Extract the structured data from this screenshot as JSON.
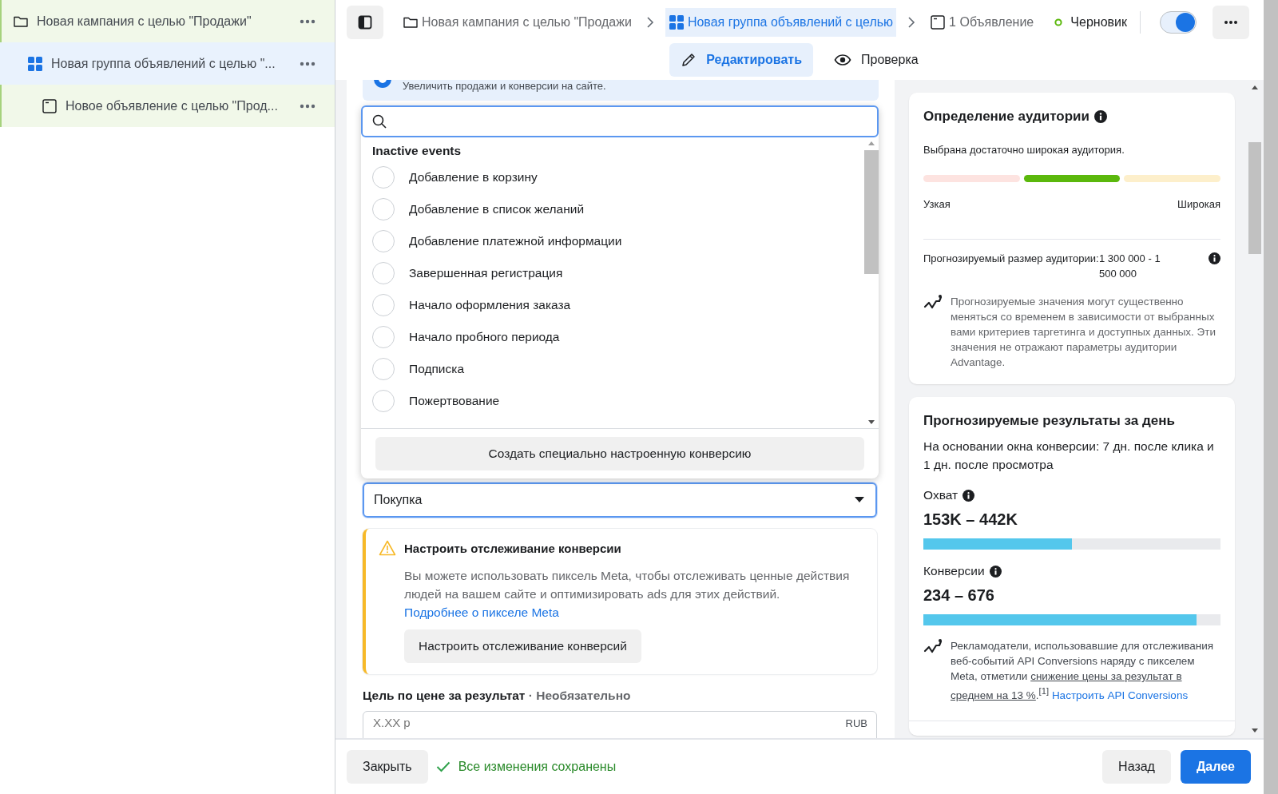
{
  "sidebar": {
    "items": [
      {
        "label": "Новая кампания с целью \"Продажи\"",
        "kind": "campaign",
        "selected": false,
        "children": [
          {
            "label": "Новая группа объявлений с целью \"...",
            "kind": "adset",
            "selected": true,
            "children": [
              {
                "label": "Новое объявление с целью \"Прод...",
                "kind": "ad",
                "selected": false
              }
            ]
          }
        ]
      }
    ]
  },
  "breadcrumbs": [
    {
      "label": "Новая кампания с целью \"Продажи",
      "kind": "campaign",
      "selected": false
    },
    {
      "label": "Новая группа объявлений с целью",
      "kind": "adset",
      "selected": true
    },
    {
      "label": "1 Объявление",
      "kind": "ad",
      "selected": false
    }
  ],
  "status": {
    "label": "Черновик"
  },
  "toggle": {
    "on": true
  },
  "tabs": [
    {
      "label": "Редактировать",
      "kind": "edit",
      "selected": true
    },
    {
      "label": "Проверка",
      "kind": "review",
      "selected": false
    }
  ],
  "objective": {
    "description": "Увеличить продажи и конверсии на сайте.",
    "selected": true
  },
  "event_dropdown": {
    "group_title": "Inactive events",
    "options": [
      {
        "label": "Добавление в корзину",
        "selected": false
      },
      {
        "label": "Добавление в список желаний",
        "selected": false
      },
      {
        "label": "Добавление платежной информации",
        "selected": false
      },
      {
        "label": "Завершенная регистрация",
        "selected": false
      },
      {
        "label": "Начало оформления заказа",
        "selected": false
      },
      {
        "label": "Начало пробного периода",
        "selected": false
      },
      {
        "label": "Подписка",
        "selected": false
      },
      {
        "label": "Пожертвование",
        "selected": false
      }
    ],
    "create_button": "Создать специально настроенную конверсию"
  },
  "conversion_select": {
    "value": "Покупка"
  },
  "warning": {
    "title": "Настроить отслеживание конверсии",
    "text": "Вы можете использовать пиксель Meta, чтобы отслеживать ценные действия людей на вашем сайте и оптимизировать ads для этих действий.",
    "link": "Подробнее о пикселе Meta",
    "button": "Настроить отслеживание конверсий"
  },
  "cost_goal": {
    "label": "Цель по цене за результат",
    "optional": "· Необязательно",
    "placeholder": "X.XX р",
    "currency": "RUB"
  },
  "audience_card": {
    "title": "Определение аудитории",
    "summary": "Выбрана достаточно широкая аудитория.",
    "segments": [
      {
        "selected": false
      },
      {
        "selected": true
      },
      {
        "selected": false
      }
    ],
    "left_label": "Узкая",
    "right_label": "Широкая",
    "size_label": "Прогнозируемый размер аудитории:",
    "size_value": "1 300 000 - 1 500 000",
    "note": "Прогнозируемые значения могут существенно меняться со временем в зависимости от выбранных вами критериев таргетинга и доступных данных. Эти значения не отражают параметры аудитории Advantage."
  },
  "results_card": {
    "title": "Прогнозируемые результаты за день",
    "subtitle": "На основании окна конверсии: 7 дн. после клика и 1 дн. после просмотра",
    "metrics": [
      {
        "label": "Охват",
        "value": "153K – 442K",
        "level": 0.5
      },
      {
        "label": "Конверсии",
        "value": "234 – 676",
        "level": 0.92
      }
    ],
    "note": {
      "text": "Рекламодатели, использовавшие для отслеживания веб-событий API Conversions наряду с пикселем Meta, отметили ",
      "underlined": "снижение цены за результат в среднем на 13 %",
      "after": ".$^{[1]}$ ",
      "link": "Настроить API Conversions"
    }
  },
  "footer": {
    "close_button": "Закрыть",
    "saved": "Все изменения сохранены",
    "back_button": "Назад",
    "next_button": "Далее"
  }
}
